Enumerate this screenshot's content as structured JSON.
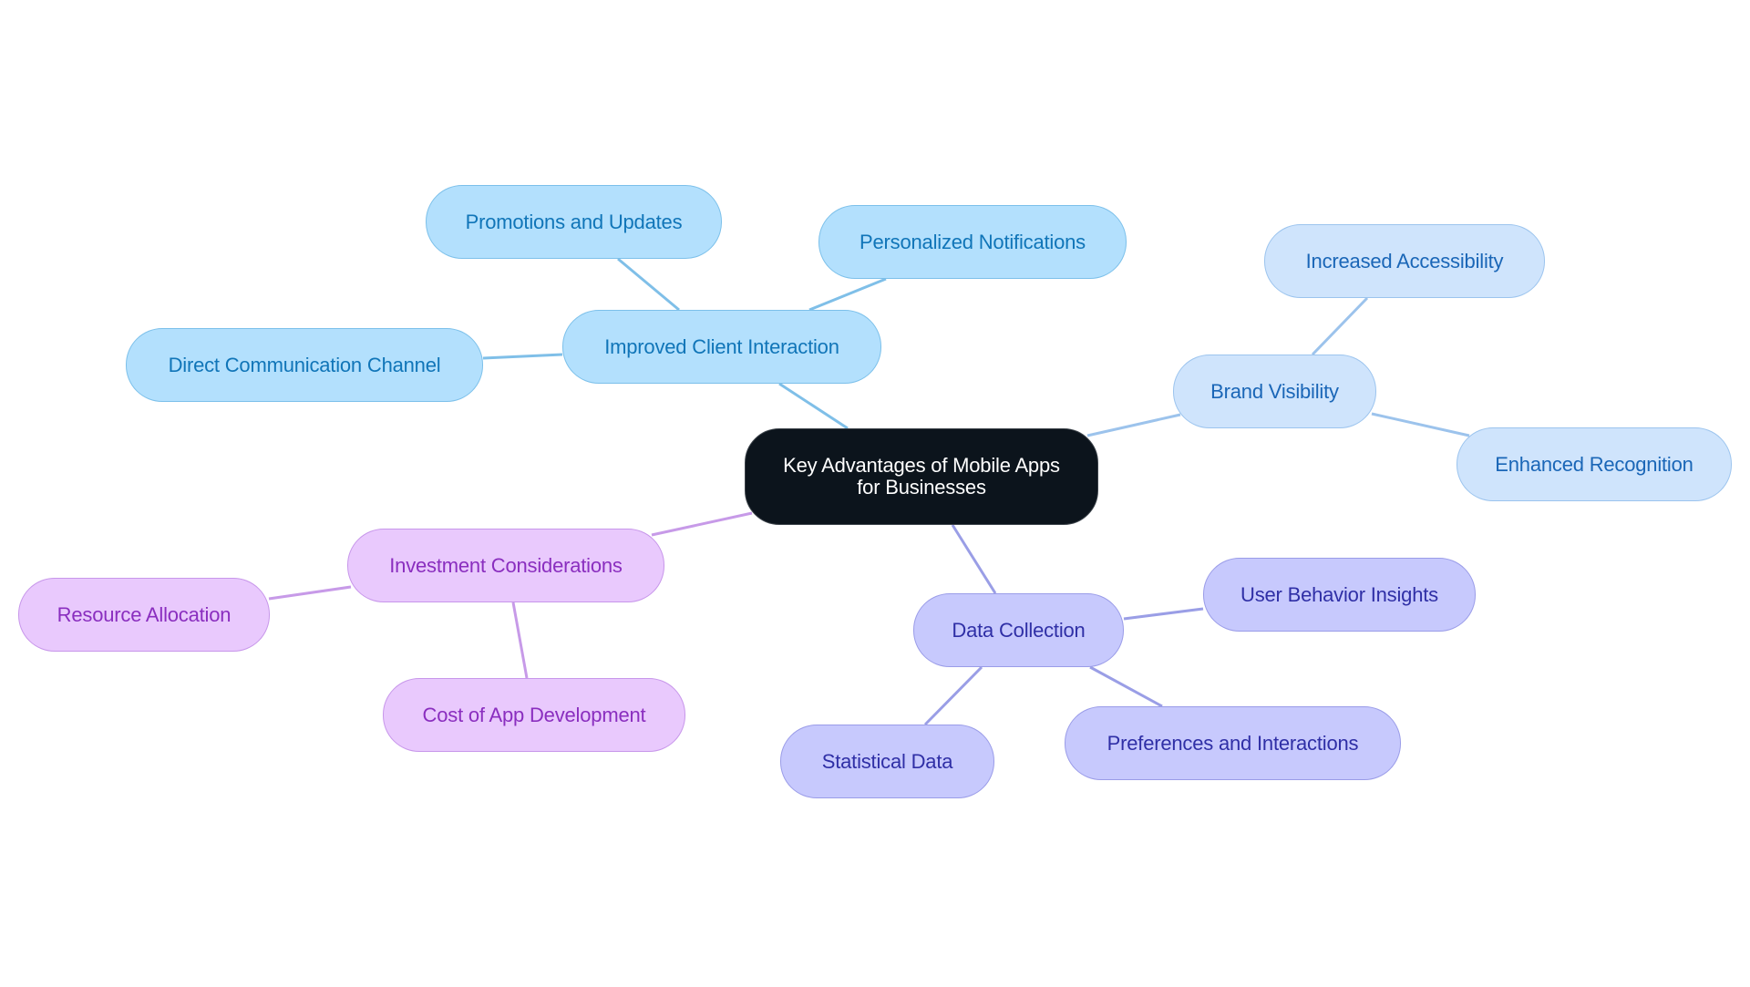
{
  "diagram": {
    "type": "mind-map",
    "root": {
      "id": "root",
      "label_line1": "Key Advantages of Mobile Apps",
      "label_line2": "for Businesses"
    },
    "colors": {
      "root_fill": "#0c141c",
      "client_branch": "#b3e0fd",
      "client_edge": "#7fbfe8",
      "brand_branch": "#cfe4fc",
      "brand_edge": "#9cc3ec",
      "data_branch": "#c7c9fd",
      "data_edge": "#9a9ee6",
      "invest_branch": "#e9c9fd",
      "invest_edge": "#c79ae8"
    },
    "branches": [
      {
        "id": "client",
        "label": "Improved Client Interaction",
        "children": [
          {
            "id": "promotions",
            "label": "Promotions and Updates"
          },
          {
            "id": "personalized",
            "label": "Personalized Notifications"
          },
          {
            "id": "direct",
            "label": "Direct Communication Channel"
          }
        ]
      },
      {
        "id": "brand",
        "label": "Brand Visibility",
        "children": [
          {
            "id": "accessibility",
            "label": "Increased Accessibility"
          },
          {
            "id": "recognition",
            "label": "Enhanced Recognition"
          }
        ]
      },
      {
        "id": "data",
        "label": "Data Collection",
        "children": [
          {
            "id": "behavior",
            "label": "User Behavior Insights"
          },
          {
            "id": "preferences",
            "label": "Preferences and Interactions"
          },
          {
            "id": "statistical",
            "label": "Statistical Data"
          }
        ]
      },
      {
        "id": "invest",
        "label": "Investment Considerations",
        "children": [
          {
            "id": "resource",
            "label": "Resource Allocation"
          },
          {
            "id": "cost",
            "label": "Cost of App Development"
          }
        ]
      }
    ]
  }
}
